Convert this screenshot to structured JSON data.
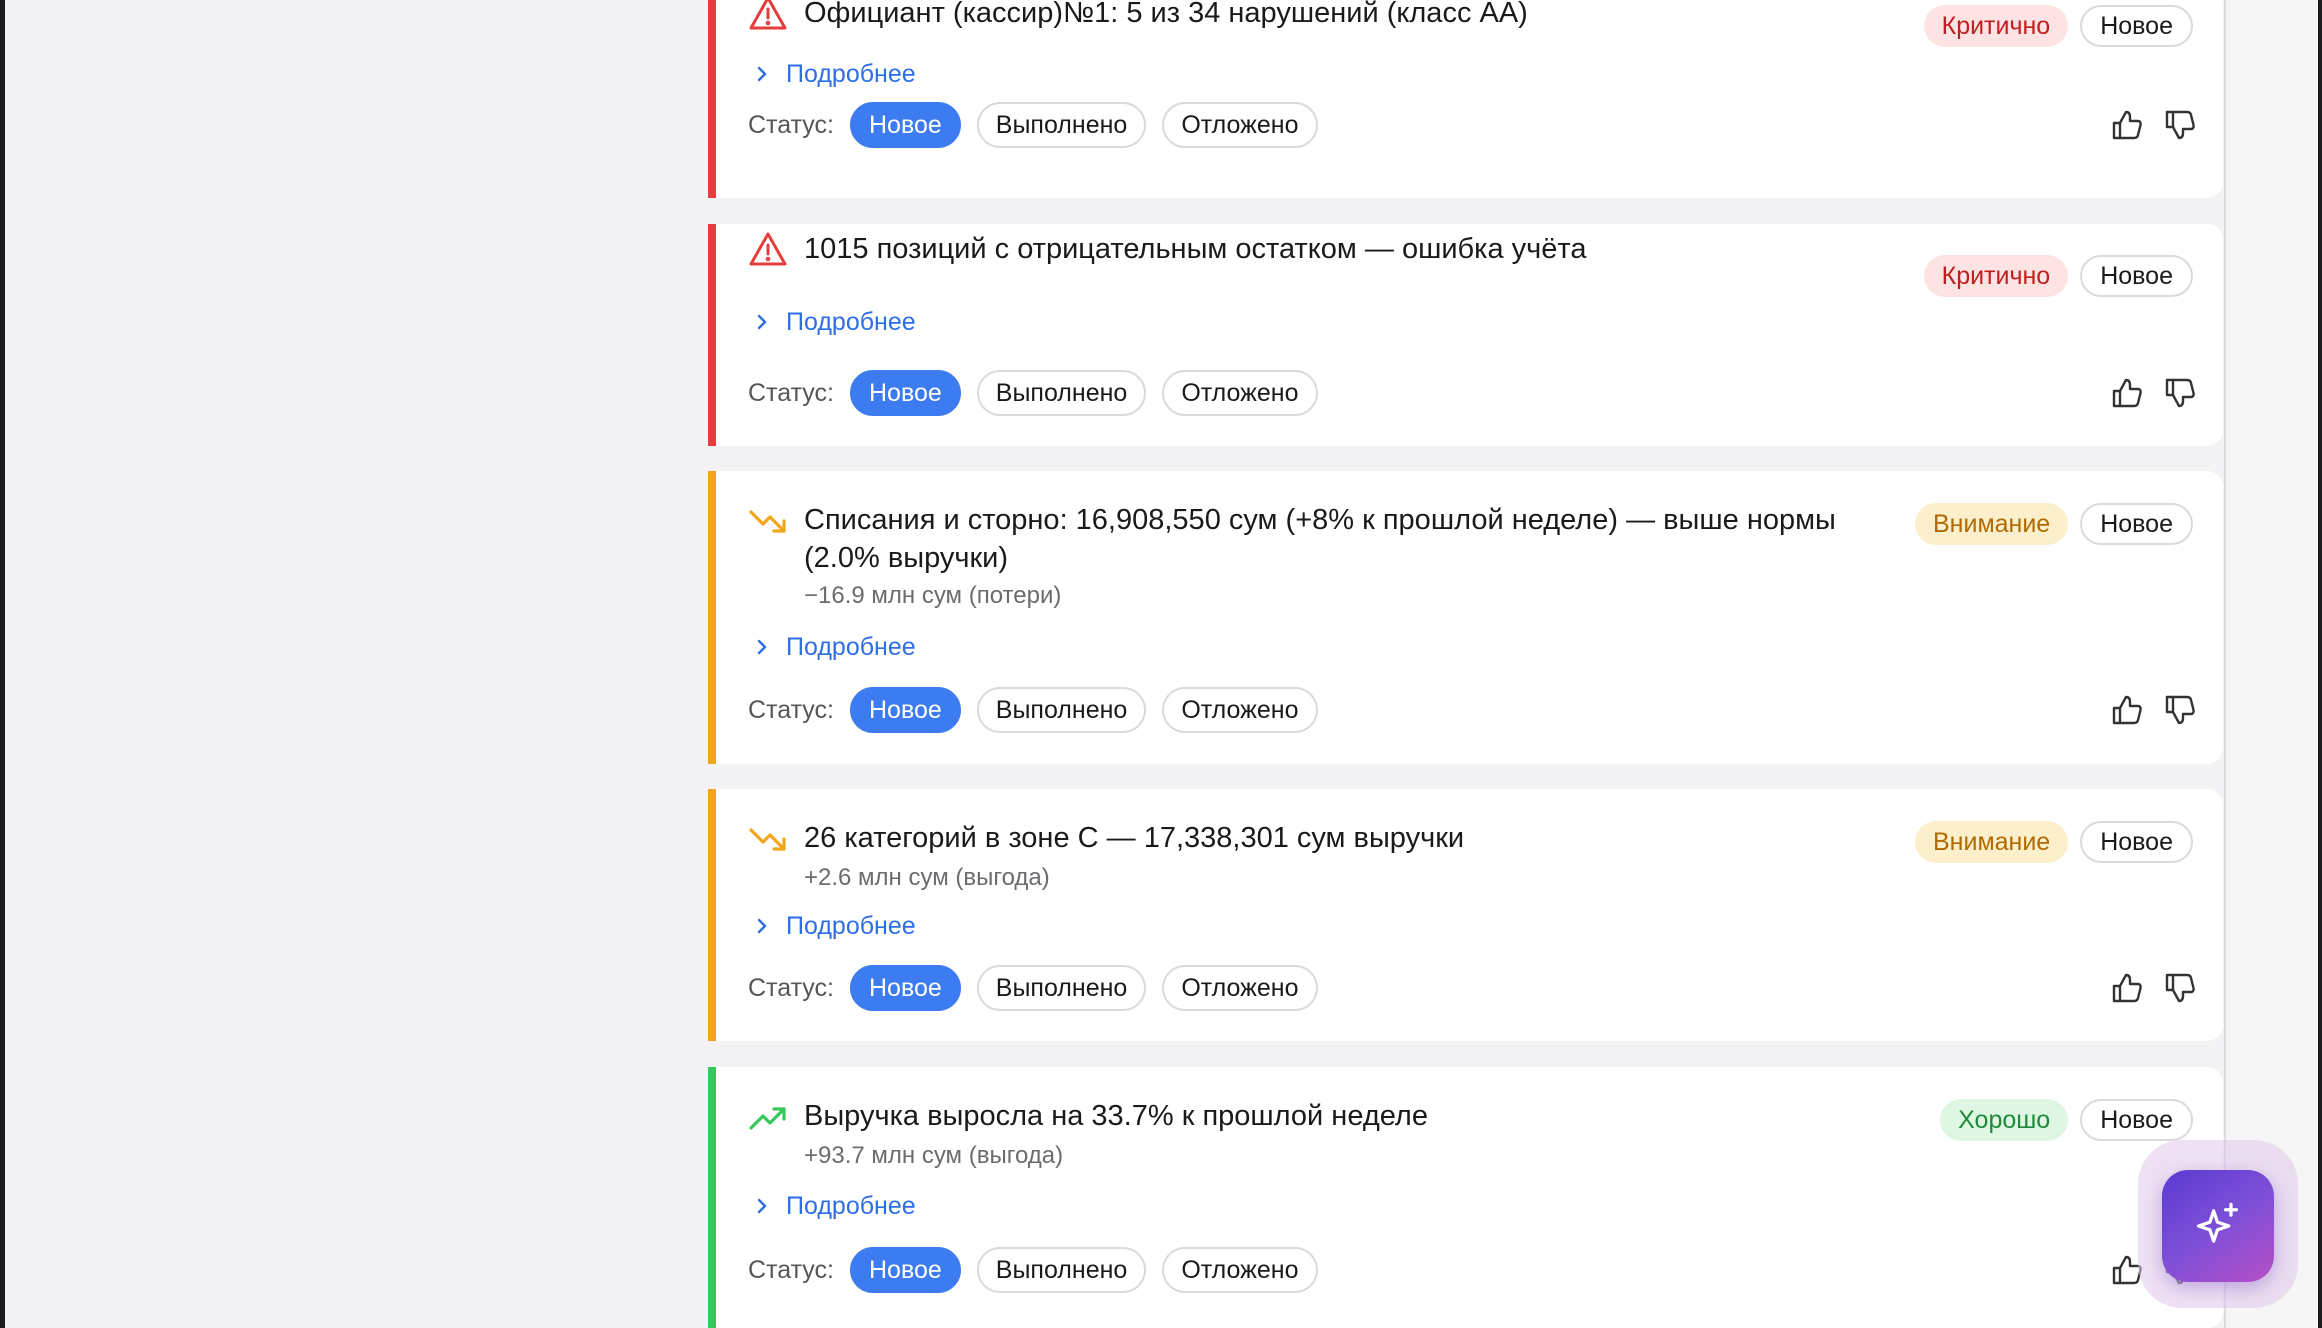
{
  "colors": {
    "critical": "#e53c3c",
    "warning": "#f3a51b",
    "good": "#34c759",
    "link": "#2f6fe6",
    "active_status": "#3d7cf0"
  },
  "status_label": "Статус:",
  "status_options": [
    "Новое",
    "Выполнено",
    "Отложено"
  ],
  "details_label": "Подробнее",
  "cards": [
    {
      "severity": "critical",
      "icon": "alert-triangle-icon",
      "title": "Официант (кассир)№1: 5 из 34 нарушений (класс АА)",
      "subtitle": "",
      "severity_label": "Критично",
      "state_label": "Новое",
      "active_status": "Новое"
    },
    {
      "severity": "critical",
      "icon": "alert-triangle-icon",
      "title": "1015 позиций с отрицательным остатком — ошибка учёта",
      "subtitle": "",
      "severity_label": "Критично",
      "state_label": "Новое",
      "active_status": "Новое"
    },
    {
      "severity": "warning",
      "icon": "trend-down-icon",
      "title": "Списания и сторно: 16,908,550 сум (+8% к прошлой неделе) — выше нормы (2.0% выручки)",
      "subtitle": "−16.9 млн сум (потери)",
      "severity_label": "Внимание",
      "state_label": "Новое",
      "active_status": "Новое"
    },
    {
      "severity": "warning",
      "icon": "trend-down-icon",
      "title": "26 категорий в зоне С — 17,338,301 сум выручки",
      "subtitle": "+2.6 млн сум (выгода)",
      "severity_label": "Внимание",
      "state_label": "Новое",
      "active_status": "Новое"
    },
    {
      "severity": "good",
      "icon": "trend-up-icon",
      "title": "Выручка выросла на 33.7% к прошлой неделе",
      "subtitle": "+93.7 млн сум (выгода)",
      "severity_label": "Хорошо",
      "state_label": "Новое",
      "active_status": "Новое"
    }
  ],
  "assistant_button": {
    "icon": "sparkles-icon"
  }
}
